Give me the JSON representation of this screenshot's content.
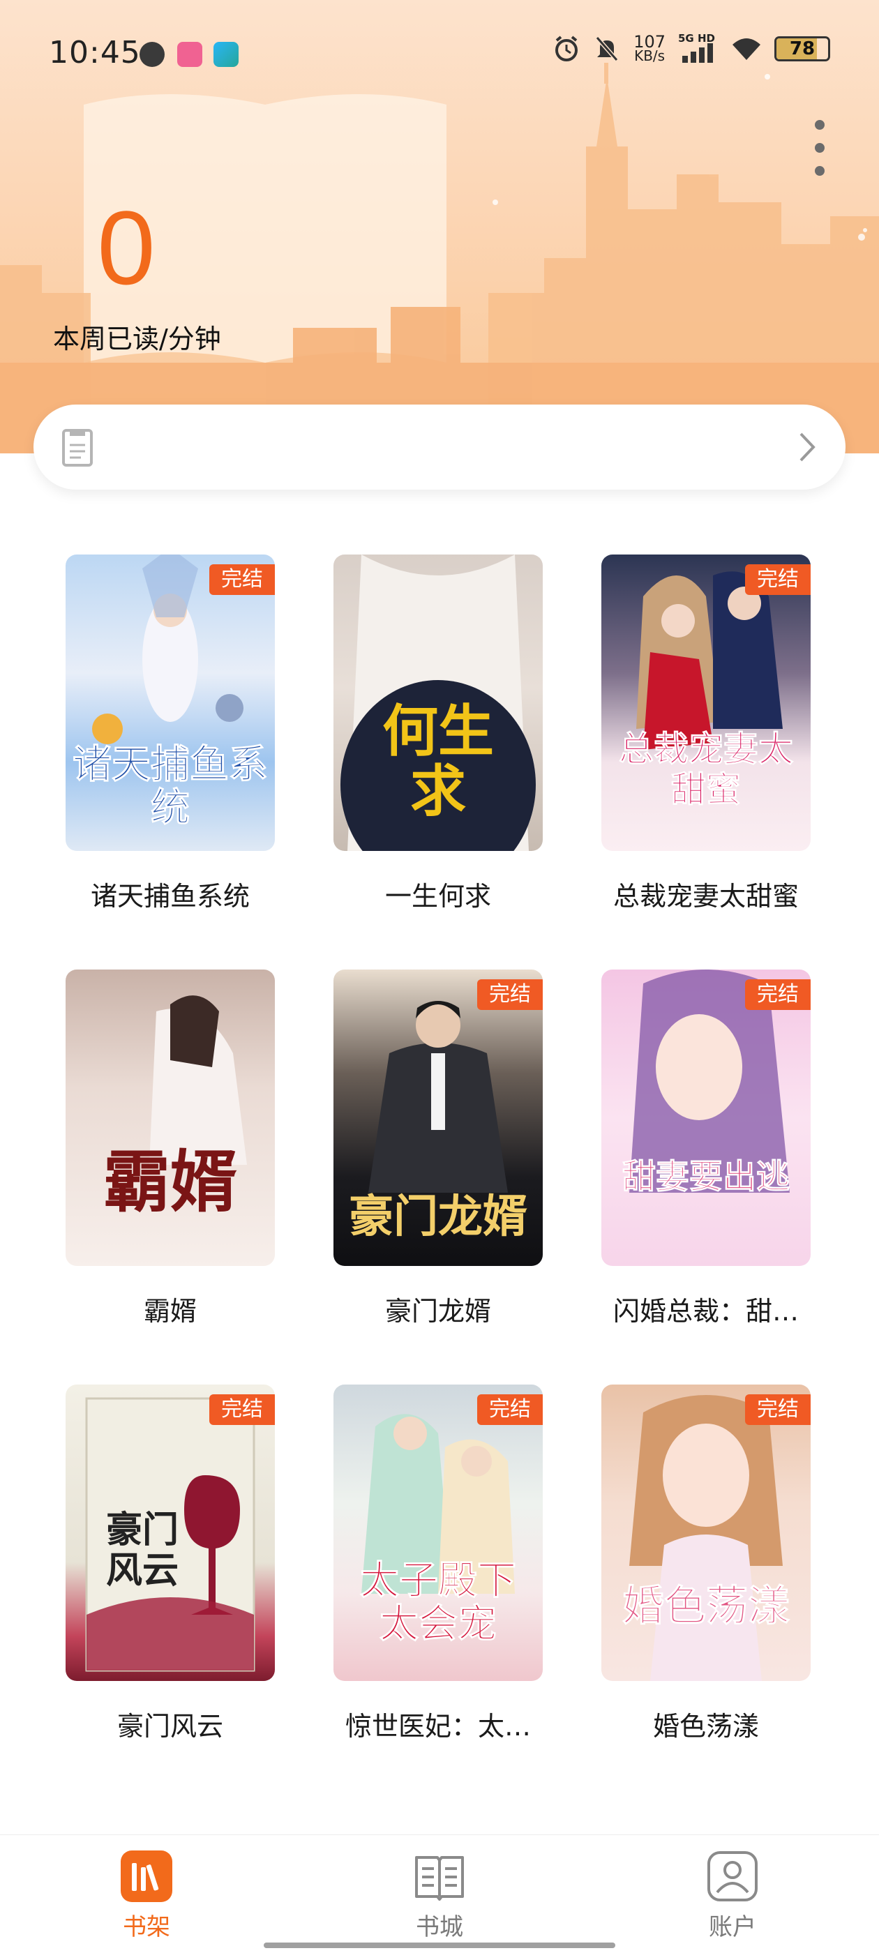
{
  "status_bar": {
    "time": "10:45",
    "net_speed_value": "107",
    "net_speed_unit": "KB/s",
    "network": "5G HD",
    "battery": "78",
    "icons": [
      "cat-app-icon",
      "bilibili-icon",
      "flight-app-icon",
      "alarm-icon",
      "mute-icon",
      "signal-icon",
      "wifi-icon",
      "battery-icon"
    ]
  },
  "header": {
    "read_minutes": "0",
    "read_label": "本周已读/分钟",
    "more_icon": "more-vertical-icon"
  },
  "notice": {
    "text": "",
    "icon": "document-icon",
    "arrow_icon": "chevron-right-icon"
  },
  "books": [
    {
      "title": "诸天捕鱼系统",
      "cover_text": "诸天捕鱼系统",
      "completed": true,
      "badge": "完结"
    },
    {
      "title": "一生何求",
      "cover_text": "何生求",
      "completed": false,
      "badge": ""
    },
    {
      "title": "总裁宠妻太甜蜜",
      "cover_text": "总裁宠妻太甜蜜",
      "completed": true,
      "badge": "完结"
    },
    {
      "title": "霸婿",
      "cover_text": "霸婿",
      "completed": false,
      "badge": ""
    },
    {
      "title": "豪门龙婿",
      "cover_text": "豪门龙婿",
      "completed": true,
      "badge": "完结"
    },
    {
      "title": "闪婚总裁：甜…",
      "cover_text": "甜妻要出逃",
      "completed": true,
      "badge": "完结"
    },
    {
      "title": "豪门风云",
      "cover_text": "豪门风云",
      "completed": true,
      "badge": "完结"
    },
    {
      "title": "惊世医妃：太…",
      "cover_text": "太子殿下太会宠",
      "completed": true,
      "badge": "完结"
    },
    {
      "title": "婚色荡漾",
      "cover_text": "婚色荡漾",
      "completed": true,
      "badge": "完结"
    }
  ],
  "bottom_nav": [
    {
      "label": "书架",
      "icon": "bookshelf-icon",
      "active": true
    },
    {
      "label": "书城",
      "icon": "bookstore-icon",
      "active": false
    },
    {
      "label": "账户",
      "icon": "account-icon",
      "active": false
    }
  ],
  "colors": {
    "accent": "#f26a1b",
    "badge": "#f05a24",
    "header_bg": "#fcd6b5"
  }
}
